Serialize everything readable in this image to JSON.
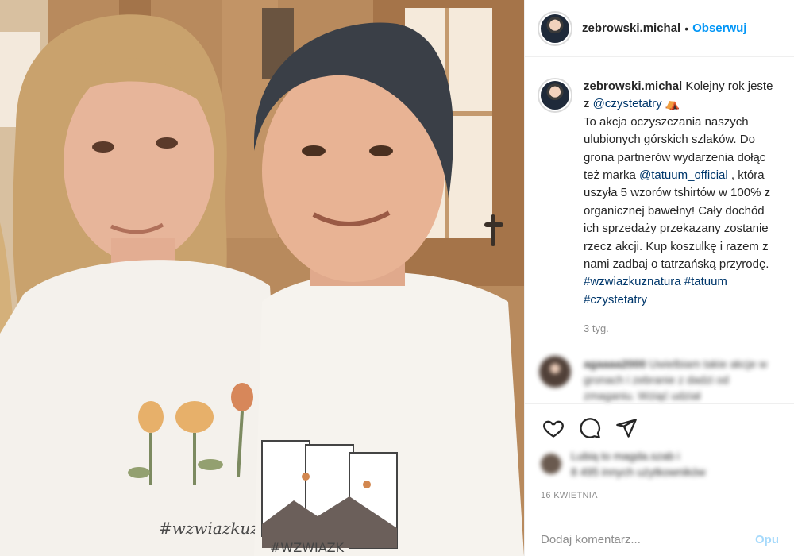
{
  "post": {
    "image_alt": "Selfie of two people in white t-shirts inside a wooden cabin",
    "shirt_left_text": "#wzwiazkuz",
    "shirt_right_text": "#WZWIAZK"
  },
  "header": {
    "username": "zebrowski.michal",
    "separator": "•",
    "follow_label": "Obserwuj",
    "avatar_icon": "user-avatar-icon"
  },
  "caption": {
    "username": "zebrowski.michal",
    "lines": [
      "Kolejny rok jeste",
      "z ",
      "To akcja oczyszczania naszych",
      "ulubionych górskich szlaków. Do",
      "grona partnerów wydarzenia dołąc",
      "też marka ",
      " , która",
      "uszyła 5 wzorów tshirtów w 100% z",
      "organicznej bawełny! Cały dochód",
      "ich sprzedaży przekazany zostanie",
      "rzecz akcji. Kup koszulkę i razem z",
      "nami zadbaj o tatrzańską przyrodę."
    ],
    "mention_1": "@czystetatry",
    "mention_1_emoji": "⛺",
    "mention_2": "@tatuum_official",
    "hashtags_line_1": "#wzwiazkuznatura #tatuum",
    "hashtags_line_2": "#czystetatry",
    "time": "3 tyg."
  },
  "comment": {
    "username": "agaaaa2000",
    "text": "Uwielbiam takie akcje w",
    "text_line_2": "gronach i zebranie z dadzi od",
    "text_line_3": "zmaganiu. Wziąć udział"
  },
  "actions": {
    "like_icon": "heart-icon",
    "comment_icon": "comment-icon",
    "share_icon": "send-icon"
  },
  "likes": {
    "line_1": "Lubią to magda.szab i",
    "line_2": "8 495 innych użytkowników"
  },
  "date": "16 KWIETNIA",
  "comment_input": {
    "placeholder": "Dodaj komentarz...",
    "post_label": "Opu"
  }
}
